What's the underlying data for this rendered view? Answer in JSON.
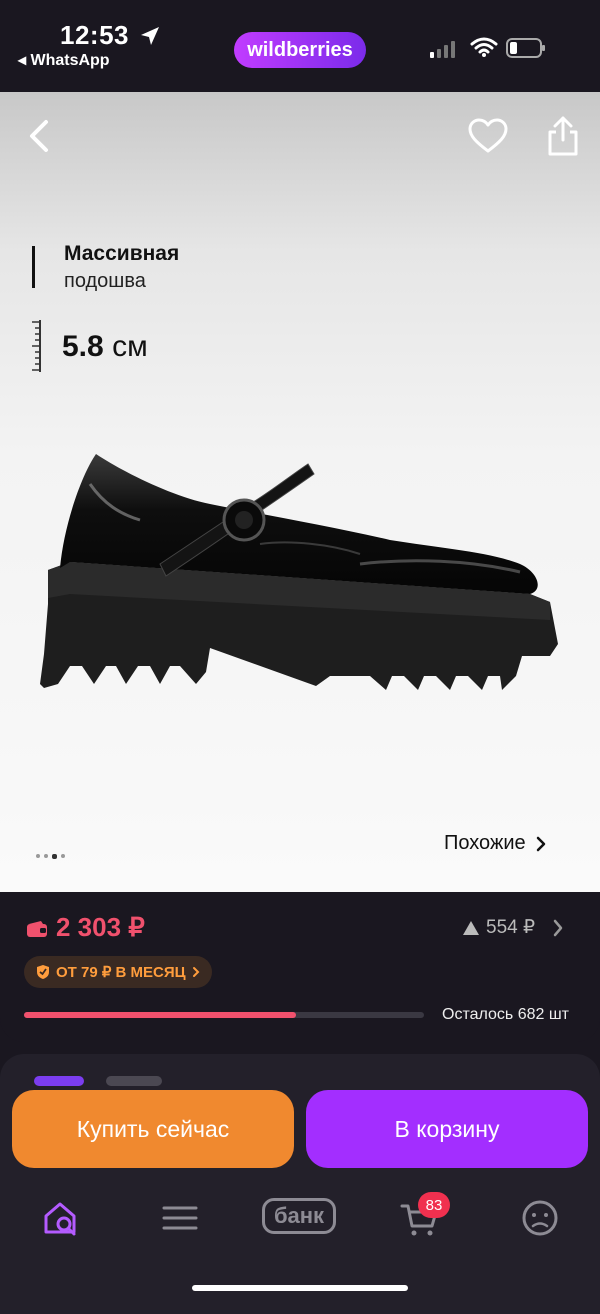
{
  "status_bar": {
    "time": "12:53",
    "back_app": "◂ WhatsApp",
    "brand": "wildberries"
  },
  "product": {
    "feature_title": "Массивная",
    "feature_subtitle": "подошва",
    "feature_height": "5.8",
    "feature_height_unit": "см",
    "similar_label": "Похожие",
    "gallery_dots": 4,
    "gallery_active_index": 2
  },
  "price": {
    "current": "2 303 ₽",
    "old": "554 ₽",
    "installment": "ОТ 79 ₽ В МЕСЯЦ",
    "remaining": "Осталось 682 шт",
    "stock_fraction": 0.68
  },
  "actions": {
    "buy_now": "Купить сейчас",
    "add_to_cart": "В корзину"
  },
  "tabbar": {
    "bank": "банк",
    "cart_count": "83"
  },
  "colors": {
    "accent_pink": "#f0516d",
    "buy_orange": "#f0892f",
    "cart_purple": "#a32eff",
    "bg_dark": "#1a1720"
  },
  "icons": [
    "back-icon",
    "heart-icon",
    "share-icon",
    "ruler-icon",
    "wallet-icon",
    "shield-icon",
    "home-search-icon",
    "menu-icon",
    "cart-icon",
    "profile-icon"
  ]
}
